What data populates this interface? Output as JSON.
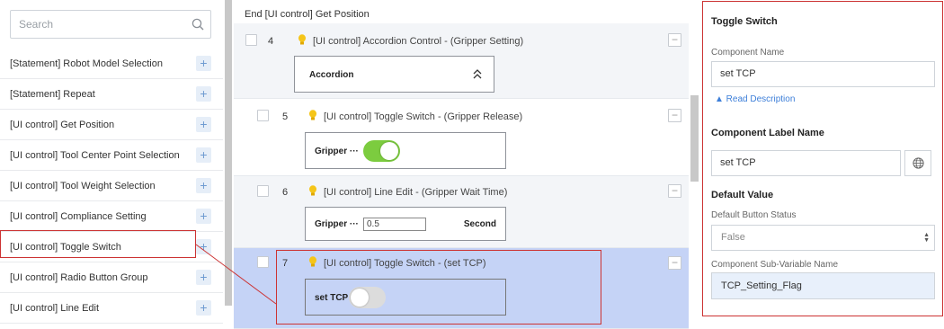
{
  "search": {
    "placeholder": "Search"
  },
  "commands": [
    {
      "label": "[Statement] Robot Model Selection"
    },
    {
      "label": "[Statement] Repeat"
    },
    {
      "label": "[UI control] Get Position"
    },
    {
      "label": "[UI control] Tool Center Point Selection"
    },
    {
      "label": "[UI control] Tool Weight Selection"
    },
    {
      "label": "[UI control] Compliance Setting"
    },
    {
      "label": "[UI control] Toggle Switch"
    },
    {
      "label": "[UI control] Radio Button Group"
    },
    {
      "label": "[UI control] Line Edit"
    }
  ],
  "program": {
    "partial_top": "End [UI control] Get Position",
    "steps": [
      {
        "num": "4",
        "title": "[UI control] Accordion Control - (Gripper Setting)",
        "preview_label": "Accordion"
      },
      {
        "num": "5",
        "title": "[UI control] Toggle Switch - (Gripper Release)",
        "preview_label": "Gripper ···",
        "toggle_state": "on"
      },
      {
        "num": "6",
        "title": "[UI control] Line Edit - (Gripper Wait Time)",
        "preview_label": "Gripper ···",
        "edit_value": "0.5",
        "unit": "Second"
      },
      {
        "num": "7",
        "title": "[UI control] Toggle Switch - (set TCP)",
        "preview_label": "set TCP",
        "toggle_state": "off"
      }
    ]
  },
  "properties": {
    "title": "Toggle Switch",
    "component_name_label": "Component Name",
    "component_name_value": "set TCP",
    "read_description": "▲ Read Description",
    "label_name_heading": "Component Label Name",
    "label_name_value": "set TCP",
    "default_value_heading": "Default Value",
    "default_button_status_label": "Default Button Status",
    "default_button_status_value": "False",
    "sub_variable_label": "Component Sub-Variable Name",
    "sub_variable_value": "TCP_Setting_Flag"
  },
  "colors": {
    "accent_blue": "#3d7fd9",
    "selected_row": "#c5d3f6",
    "toggle_on": "#7ccc3f",
    "highlight_red": "#cc3333"
  },
  "icons": [
    "search-icon",
    "plus-icon",
    "lightbulb-icon",
    "minus-icon",
    "chevron-double-up-icon",
    "globe-icon",
    "select-arrows-icon"
  ]
}
